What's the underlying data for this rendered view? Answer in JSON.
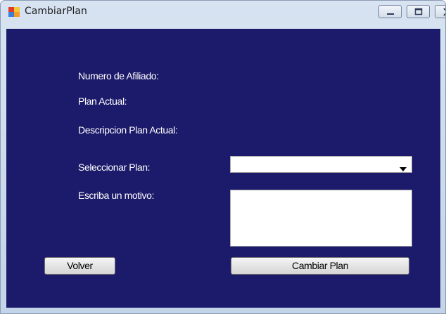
{
  "window": {
    "title": "CambiarPlan",
    "app_icon": "windows-form-icon",
    "controls": [
      "minimize-icon",
      "maximize-icon",
      "close-icon"
    ]
  },
  "form": {
    "background_color": "#1c1a6a",
    "labels": {
      "numero_afiliado": "Numero de Afiliado:",
      "plan_actual": "Plan Actual:",
      "descripcion_plan_actual": "Descripcion Plan Actual:",
      "seleccionar_plan": "Seleccionar Plan:",
      "motivo": "Escriba un motivo:"
    },
    "plan_select": {
      "value": ""
    },
    "motivo_input": {
      "value": ""
    },
    "buttons": {
      "volver": "Volver",
      "cambiar_plan": "Cambiar Plan"
    }
  }
}
